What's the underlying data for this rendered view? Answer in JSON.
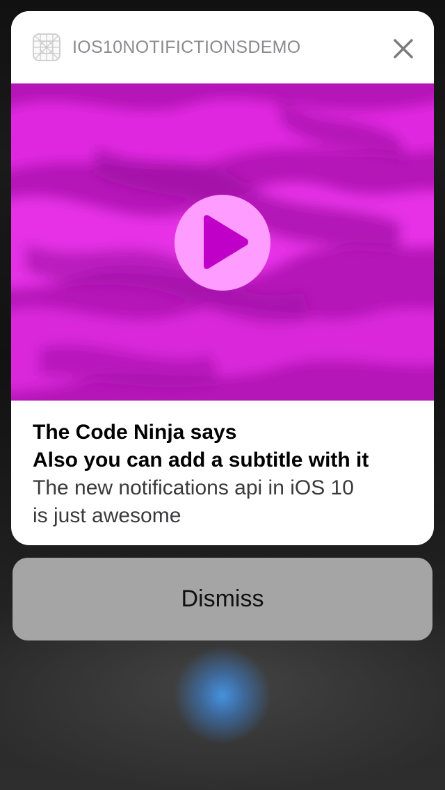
{
  "notification": {
    "app_name": "IOS10NOTIFICTIONSDEMO",
    "app_icon": "app-icon-grid",
    "close_icon": "close-icon",
    "media": {
      "play_icon": "play-icon",
      "colors": {
        "base": "#b516b8",
        "highlight": "#f222f2",
        "play_circle": "#ff9cff",
        "play_triangle": "#c000c8"
      }
    },
    "title": "The Code Ninja says",
    "subtitle": "Also you can add a subtitle with it",
    "body_line1": "The new notifications api in iOS 10",
    "body_line2": "is just awesome"
  },
  "actions": {
    "dismiss_label": "Dismiss"
  }
}
